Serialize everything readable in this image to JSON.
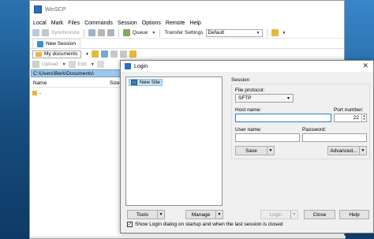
{
  "app": {
    "title": "WinSCP"
  },
  "menu": [
    "Local",
    "Mark",
    "Files",
    "Commands",
    "Session",
    "Options",
    "Remote",
    "Help"
  ],
  "toolbar": {
    "synchronize": "Synchronize",
    "queue": "Queue",
    "transfer_settings_label": "Transfer Settings",
    "transfer_settings_value": "Default"
  },
  "tab": {
    "label": "New Session"
  },
  "local_panel": {
    "location": "My documents",
    "upload": "Upload",
    "edit": "Edit",
    "path": "C:\\Users\\Berk\\Documents\\",
    "col_name": "Name",
    "col_size": "Size",
    "up_dir": ".."
  },
  "dialog": {
    "title": "Login",
    "tree_item": "New Site",
    "session_heading": "Session",
    "file_protocol_label": "File protocol:",
    "file_protocol_value": "SFTP",
    "host_name_label": "Host name:",
    "host_name_value": "",
    "port_label": "Port number:",
    "port_value": "22",
    "user_name_label": "User name:",
    "user_name_value": "",
    "password_label": "Password:",
    "password_value": "",
    "save": "Save",
    "advanced": "Advanced...",
    "tools": "Tools",
    "manage": "Manage",
    "login": "Login",
    "close": "Close",
    "help": "Help",
    "show_on_startup": "Show Login dialog on startup and when the last session is closed"
  }
}
